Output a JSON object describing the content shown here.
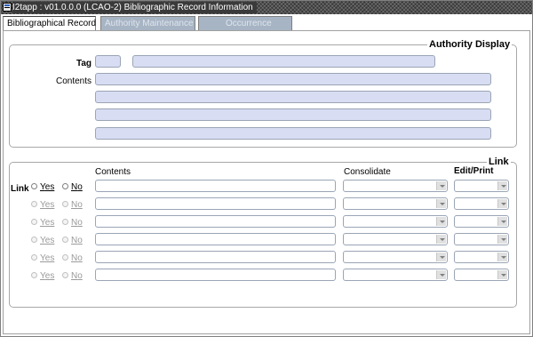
{
  "window": {
    "title": "I2tapp : v01.0.0.0 (LCAO-2) Bibliographic Record Information"
  },
  "tabs": [
    {
      "label": "Bibliographical Record"
    },
    {
      "label": "Authority Maintenance"
    },
    {
      "label": "Occurrence"
    }
  ],
  "authority": {
    "title": "Authority Display",
    "tag_label": "Tag",
    "contents_label": "Contents"
  },
  "link_section": {
    "title": "Link",
    "link_label": "Link",
    "col_contents": "Contents",
    "col_consolidate": "Consolidate",
    "col_edit_print": "Edit/Print",
    "rows": [
      {
        "yes_first": "Y",
        "yes_rest": "es",
        "no_first": "N",
        "no_rest": "o"
      },
      {
        "yes_first": "Y",
        "yes_rest": "es",
        "no_first": "N",
        "no_rest": "o"
      },
      {
        "yes_first": "Y",
        "yes_rest": "es",
        "no_first": "N",
        "no_rest": "o"
      },
      {
        "yes_first": "Y",
        "yes_rest": "es",
        "no_first": "N",
        "no_rest": "o"
      },
      {
        "yes_first": "Y",
        "yes_rest": "es",
        "no_first": "N",
        "no_rest": "o"
      },
      {
        "yes_first": "Y",
        "yes_rest": "es",
        "no_first": "N",
        "no_rest": "o"
      }
    ]
  },
  "colors": {
    "field_bg": "#d9ddf3",
    "inactive_tab": "#a7b4c4"
  }
}
